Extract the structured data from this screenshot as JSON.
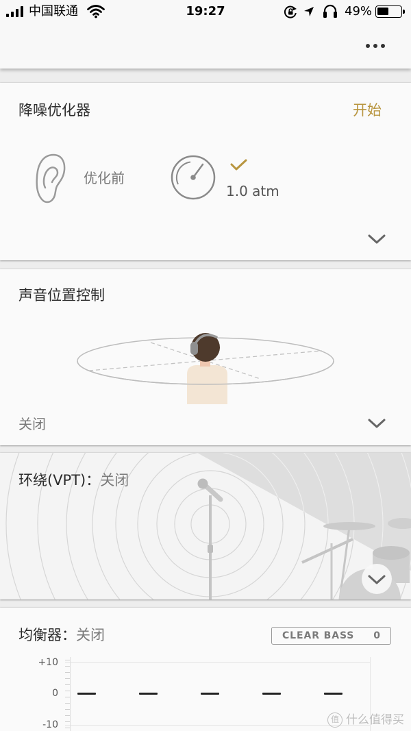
{
  "status_bar": {
    "carrier": "中国联通",
    "signal_bars": 4,
    "time": "19:27",
    "battery_percent": "49%",
    "battery_level": 0.49,
    "icons": [
      "signal-icon",
      "wifi-icon",
      "orientation-lock-icon",
      "location-icon",
      "headphones-icon",
      "battery-icon"
    ]
  },
  "header": {
    "icons": [
      "more-icon"
    ]
  },
  "sections": {
    "noise_optimizer": {
      "title": "降噪优化器",
      "action": "开始",
      "ear_state": "优化前",
      "pressure": "1.0 atm",
      "icons": [
        "ear-icon",
        "pressure-gauge-icon",
        "check-icon",
        "chevron-down-icon"
      ]
    },
    "sound_position": {
      "title": "声音位置控制",
      "status": "关闭",
      "icons": [
        "chevron-down-icon"
      ]
    },
    "surround": {
      "title": "环绕(VPT)：",
      "status": "关闭",
      "icons": [
        "chevron-down-icon"
      ]
    },
    "equalizer": {
      "title": "均衡器：",
      "status": "关闭",
      "clear_bass_label": "CLEAR BASS",
      "clear_bass_value": "0",
      "y_axis_labels": [
        "+10",
        "0",
        "-10"
      ],
      "y_range": [
        -10,
        10
      ],
      "band_levels": [
        0,
        0,
        0,
        0,
        0
      ]
    }
  },
  "watermark": {
    "badge": "值",
    "text": "什么值得买"
  },
  "colors": {
    "accent": "#b8953f",
    "text_primary": "#2c2c2c",
    "text_secondary": "#7a7a7a",
    "icon_grey": "#8a8a8a",
    "eq_level": "#222222"
  }
}
